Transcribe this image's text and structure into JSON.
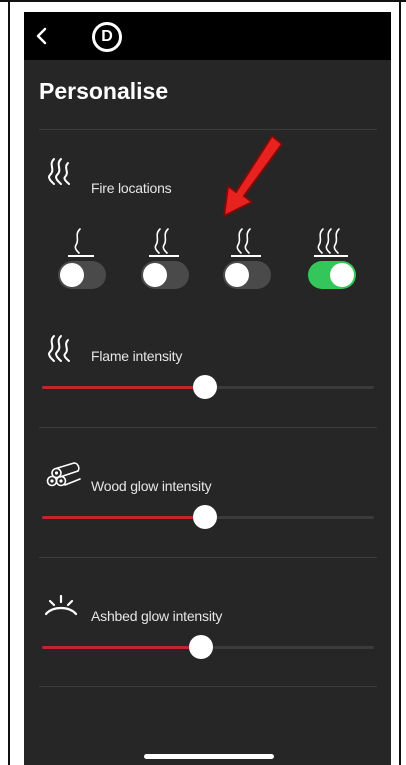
{
  "header": {
    "back_icon": "chevron-left-icon",
    "logo_letter": "D"
  },
  "page": {
    "title": "Personalise"
  },
  "fire_locations": {
    "label": "Fire locations",
    "icon": "flame-wave-icon",
    "toggles": [
      {
        "flame_count": 1,
        "on": false
      },
      {
        "flame_count": 2,
        "on": false
      },
      {
        "flame_count": 2,
        "on": false
      },
      {
        "flame_count": 3,
        "on": true
      }
    ],
    "toggle_on_color": "#34c65a"
  },
  "flame_intensity": {
    "label": "Flame intensity",
    "icon": "flame-wave-icon",
    "value_percent": 49
  },
  "wood_glow_intensity": {
    "label": "Wood glow intensity",
    "icon": "wood-logs-icon",
    "value_percent": 49
  },
  "ashbed_glow_intensity": {
    "label": "Ashbed glow intensity",
    "icon": "ashbed-glow-icon",
    "value_percent": 48
  },
  "colors": {
    "background": "#262626",
    "slider_fill": "#c0262a",
    "annotation_arrow": "#e8231f"
  },
  "annotation": {
    "icon": "red-arrow-icon"
  }
}
